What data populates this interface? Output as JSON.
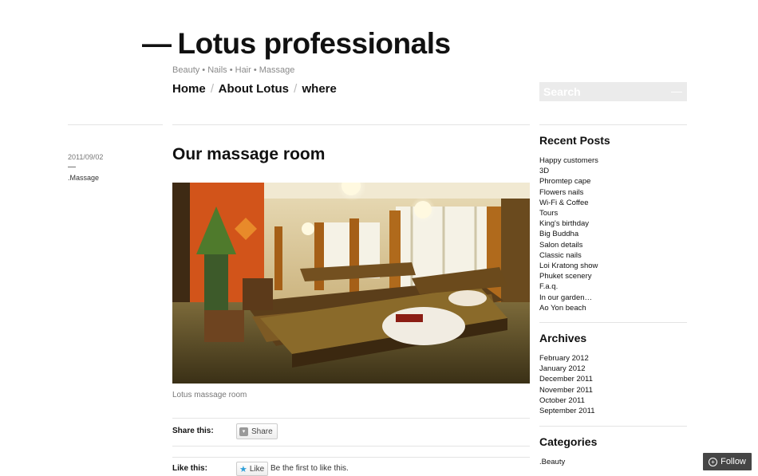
{
  "site": {
    "dash": "—",
    "title": "Lotus professionals",
    "tagline": "Beauty • Nails • Hair • Massage"
  },
  "nav": {
    "items": [
      "Home",
      "About Lotus",
      "where"
    ],
    "separator": "/"
  },
  "search": {
    "placeholder": "Search",
    "go": "—"
  },
  "post": {
    "date": "2011/09/02",
    "dash": "—",
    "category": ".Massage",
    "title": "Our massage room",
    "caption": "Lotus massage room",
    "share_label": "Share this:",
    "share_button": "Share",
    "like_label": "Like this:",
    "like_button": "Like",
    "like_text": "Be the first to like this."
  },
  "sidebar": {
    "recent": {
      "title": "Recent Posts",
      "items": [
        "Happy customers",
        "3D",
        "Phromtep cape",
        "Flowers nails",
        "Wi-Fi & Coffee",
        "Tours",
        "King's birthday",
        "Big Buddha",
        "Salon details",
        "Classic nails",
        "Loi Kratong show",
        "Phuket scenery",
        "F.a.q.",
        "In our garden…",
        "Ao Yon beach"
      ]
    },
    "archives": {
      "title": "Archives",
      "items": [
        "February 2012",
        "January 2012",
        "December 2011",
        "November 2011",
        "October 2011",
        "September 2011"
      ]
    },
    "categories": {
      "title": "Categories",
      "items": [
        ".Beauty"
      ]
    }
  },
  "follow": {
    "label": "Follow",
    "icon": "plus-circle-icon"
  },
  "colors": {
    "text": "#111111",
    "meta": "#777777",
    "search_bg": "#ebebeb",
    "follow_bg": "#464646"
  }
}
